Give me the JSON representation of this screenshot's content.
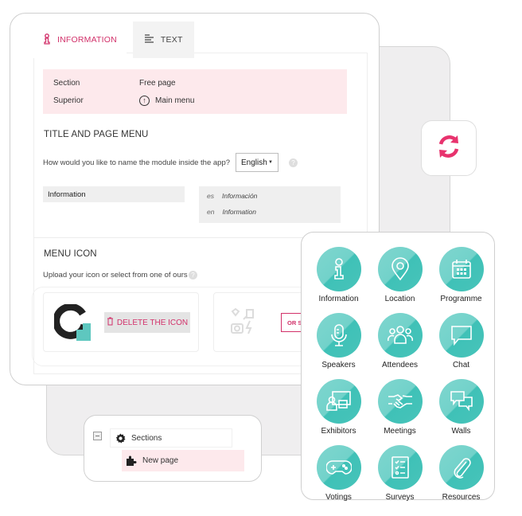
{
  "colors": {
    "accent": "#d2316a",
    "teal": "#48c4ba",
    "pink_bg": "#fde9ec",
    "panel_gray": "#efeeef"
  },
  "tabs": [
    {
      "label": "INFORMATION",
      "icon": "info-icon",
      "active": true
    },
    {
      "label": "TEXT",
      "icon": "text-align-icon",
      "active": false
    }
  ],
  "info_box": {
    "section_label": "Section",
    "section_value": "Free page",
    "superior_label": "Superior",
    "superior_value": "Main menu"
  },
  "title_section": {
    "heading": "TITLE AND PAGE MENU",
    "question": "How would you like to name the module inside the app?",
    "language_selected": "English",
    "name_value": "Information",
    "translations": [
      {
        "code": "es",
        "value": "Información"
      },
      {
        "code": "en",
        "value": "Information"
      }
    ]
  },
  "menu_icon_section": {
    "heading": "MENU ICON",
    "upload_label": "Upload your icon or select from one of ours",
    "delete_button": "DELETE THE ICON",
    "or_button": "OR S"
  },
  "tree": {
    "parent": "Sections",
    "child": "New page"
  },
  "icon_grid": [
    {
      "label": "Information",
      "icon": "info-icon"
    },
    {
      "label": "Location",
      "icon": "location-pin-icon"
    },
    {
      "label": "Programme",
      "icon": "calendar-icon"
    },
    {
      "label": "Speakers",
      "icon": "microphone-icon"
    },
    {
      "label": "Attendees",
      "icon": "people-icon"
    },
    {
      "label": "Chat",
      "icon": "chat-bubble-icon"
    },
    {
      "label": "Exhibitors",
      "icon": "exhibitor-icon"
    },
    {
      "label": "Meetings",
      "icon": "handshake-icon"
    },
    {
      "label": "Walls",
      "icon": "chat-bubbles-icon"
    },
    {
      "label": "Votings",
      "icon": "gamepad-icon"
    },
    {
      "label": "Surveys",
      "icon": "checklist-icon"
    },
    {
      "label": "Resources",
      "icon": "paperclip-icon"
    }
  ]
}
